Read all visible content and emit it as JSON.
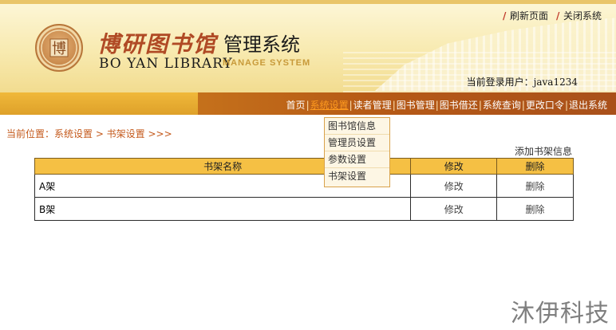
{
  "header": {
    "top_links": [
      "刷新页面",
      "关闭系统"
    ],
    "logo_cn": "博研图书馆",
    "title": "管理系统",
    "logo_en": "BO YAN LIBRARY",
    "logo_en_sub": "MANAGE SYSTEM",
    "seal_char": "博",
    "login_label": "当前登录用户：",
    "login_user": "java1234"
  },
  "nav": {
    "items": [
      "首页",
      "系统设置",
      "读者管理",
      "图书管理",
      "图书借还",
      "系统查询",
      "更改口令",
      "退出系统"
    ],
    "separator": "|",
    "active_index": 1
  },
  "dropdown": {
    "items": [
      "图书馆信息",
      "管理员设置",
      "参数设置",
      "书架设置"
    ]
  },
  "breadcrumb": "当前位置：系统设置 > 书架设置 >>>",
  "add_link": "添加书架信息",
  "table": {
    "headers": [
      "书架名称",
      "修改",
      "删除"
    ],
    "rows": [
      {
        "name": "A架",
        "edit": "修改",
        "delete": "删除"
      },
      {
        "name": "B架",
        "edit": "修改",
        "delete": "删除"
      }
    ]
  },
  "watermark": "沐伊科技",
  "colors": {
    "nav_active": "#ff9a1f",
    "breadcrumb": "#c4591b",
    "table_header": "#f5c044",
    "logo_red": "#b04a25"
  }
}
